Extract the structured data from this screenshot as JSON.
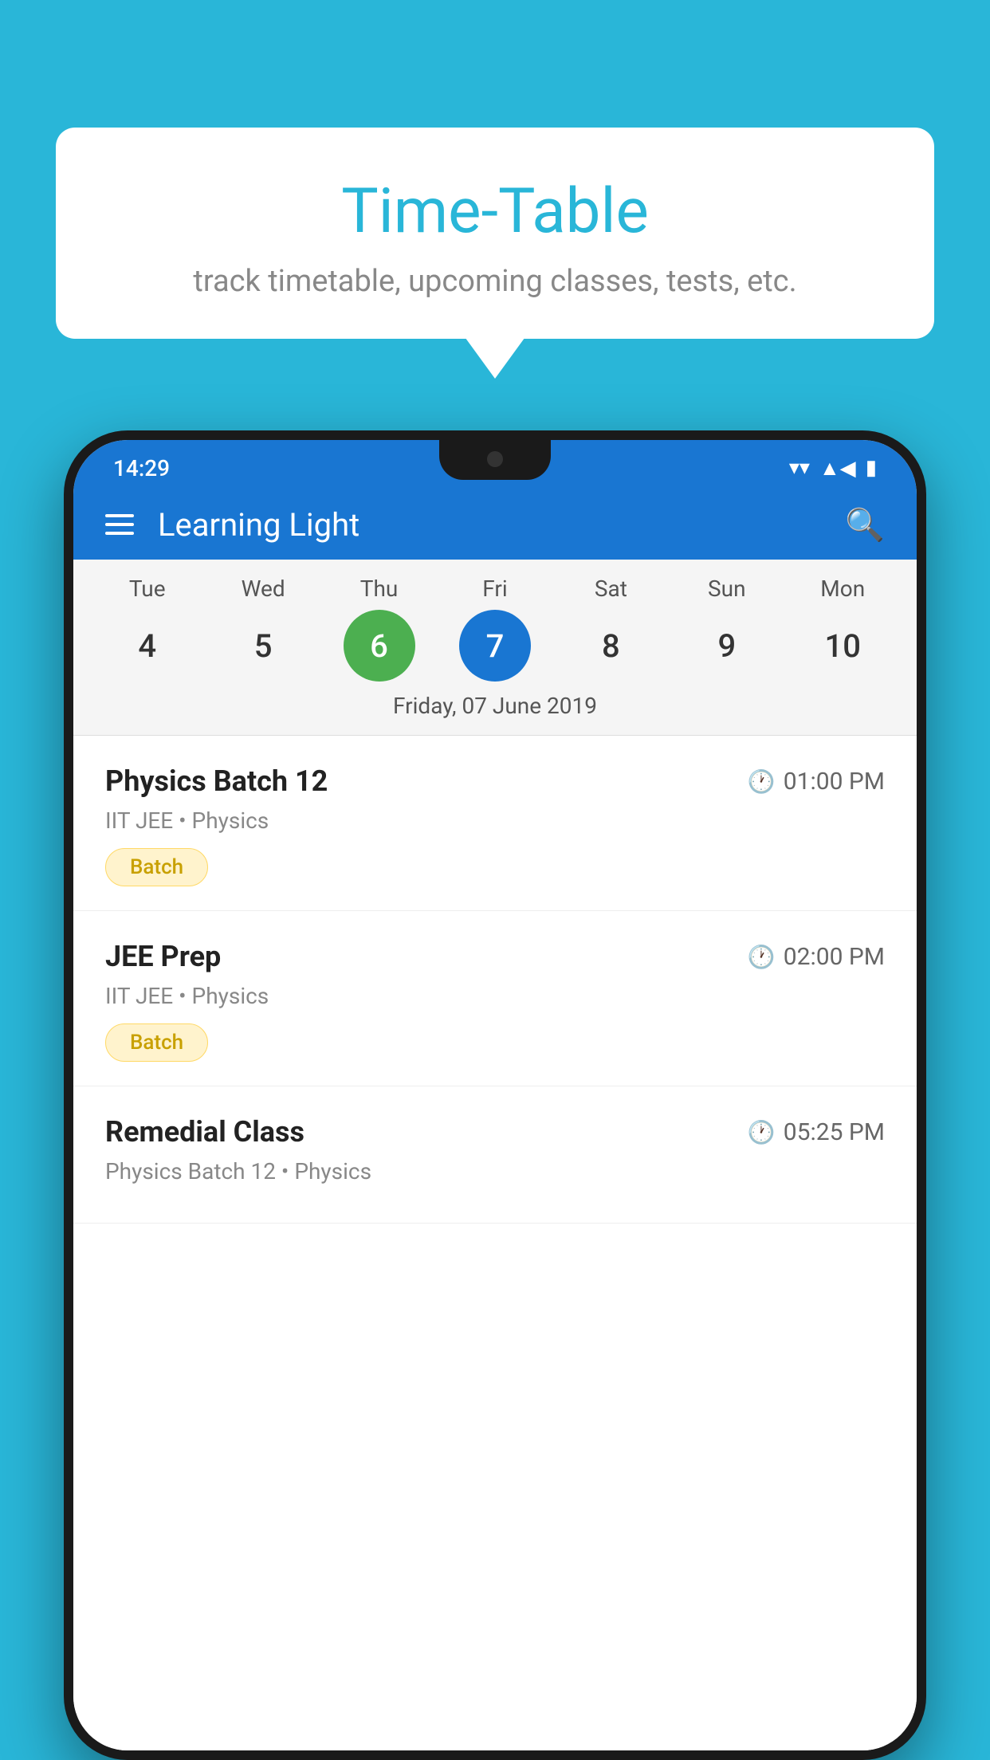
{
  "background": {
    "color": "#29b6d8"
  },
  "bubble": {
    "title": "Time-Table",
    "subtitle": "track timetable, upcoming classes, tests, etc."
  },
  "phone": {
    "statusBar": {
      "time": "14:29"
    },
    "appBar": {
      "title": "Learning Light"
    },
    "calendar": {
      "days": [
        {
          "label": "Tue",
          "date": "4"
        },
        {
          "label": "Wed",
          "date": "5"
        },
        {
          "label": "Thu",
          "date": "6"
        },
        {
          "label": "Fri",
          "date": "7"
        },
        {
          "label": "Sat",
          "date": "8"
        },
        {
          "label": "Sun",
          "date": "9"
        },
        {
          "label": "Mon",
          "date": "10"
        }
      ],
      "selectedDateLabel": "Friday, 07 June 2019"
    },
    "schedule": [
      {
        "title": "Physics Batch 12",
        "time": "01:00 PM",
        "subtitle": "IIT JEE • Physics",
        "tag": "Batch"
      },
      {
        "title": "JEE Prep",
        "time": "02:00 PM",
        "subtitle": "IIT JEE • Physics",
        "tag": "Batch"
      },
      {
        "title": "Remedial Class",
        "time": "05:25 PM",
        "subtitle": "Physics Batch 12 • Physics",
        "tag": ""
      }
    ]
  }
}
